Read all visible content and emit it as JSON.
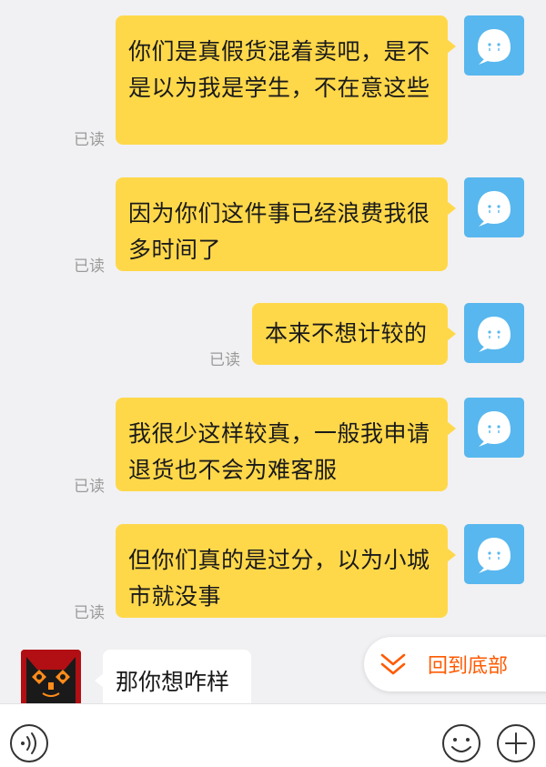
{
  "messages_out": [
    {
      "text": "你们是真假货混着卖吧，是不是以为我是学生，不在意这些",
      "read": "已读"
    },
    {
      "text": "因为你们这件事已经浪费我很多时间了",
      "read": "已读"
    },
    {
      "text": "本来不想计较的",
      "read": "已读"
    },
    {
      "text": "我很少这样较真，一般我申请退货也不会为难客服",
      "read": "已读"
    },
    {
      "text": "但你们真的是过分，以为小城市就没事",
      "read": "已读"
    }
  ],
  "message_in": {
    "text": "那你想咋样"
  },
  "back_to_bottom": {
    "label": "回到底部",
    "icon": "double-chevron-down-icon"
  },
  "input_bar": {
    "voice_icon": "voice-icon",
    "emoji_icon": "emoji-icon",
    "add_icon": "plus-icon"
  },
  "colors": {
    "outgoing_bubble": "#ffd84a",
    "incoming_bubble": "#ffffff",
    "self_avatar": "#58b7ee",
    "accent": "#ff5a00",
    "background": "#f1f1f3"
  }
}
